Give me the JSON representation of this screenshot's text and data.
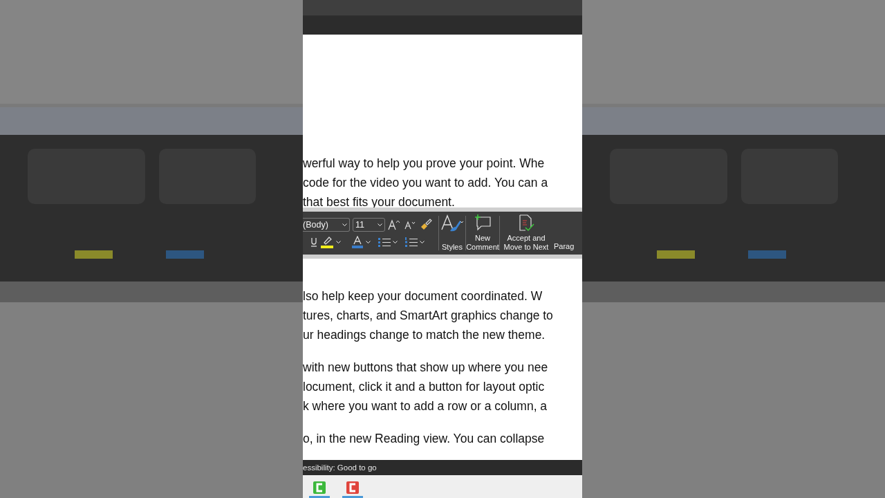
{
  "document": {
    "paragraphs": [
      {
        "lines": [
          "werful way to help you prove your point. Whe",
          "code for the video you want to add. You can a",
          "that best fits your document."
        ]
      },
      {
        "lines": [
          "lso help keep your document coordinated. W",
          "tures, charts, and SmartArt graphics change to",
          "ur headings change to match the new theme."
        ]
      },
      {
        "lines": [
          "with new buttons that show up where you nee",
          "locument, click it and a button for layout optic",
          "k where you want to add a row or a column, a"
        ]
      },
      {
        "lines": [
          "o, in the new Reading view. You can collapse"
        ]
      }
    ]
  },
  "mini_toolbar": {
    "font": "(Body)",
    "size": "11",
    "styles": "Styles",
    "new_comment": "New Comment",
    "accept": "Accept and Move to Next",
    "paragraph": "Parag"
  },
  "status_bar": {
    "text": "essibility: Good to go"
  },
  "taskbar": {
    "apps": [
      {
        "color": "#3cb83c"
      },
      {
        "color": "#e0443c"
      }
    ]
  }
}
